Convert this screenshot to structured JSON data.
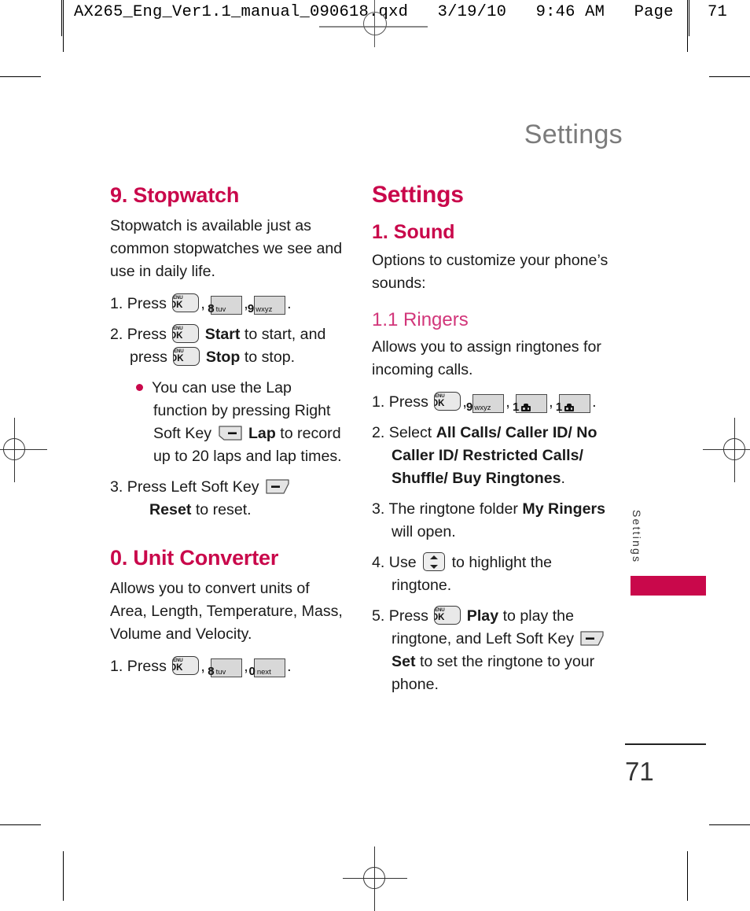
{
  "prepress": {
    "slug": "AX265_Eng_Ver1.1_manual_090618.qxd   3/19/10   9:46 AM   Page",
    "page_label": "71"
  },
  "running_header": "Settings",
  "side_tab": {
    "label": "Settings",
    "color": "#c9084b"
  },
  "folio": {
    "number": "71"
  },
  "colors": {
    "accent": "#c9084b",
    "accent_light": "#d2367a",
    "running_head": "#7b7b7b",
    "key_fill": "#d8d8d8",
    "menu_key_fill": "#e9e9e9"
  },
  "left_column": {
    "section_heading": "9. Stopwatch",
    "intro": "Stopwatch is available just as common stopwatches we see and use in daily life.",
    "step1": {
      "number": "1.",
      "verb": "Press",
      "keys": [
        "MENU/OK",
        "8 tuv",
        "9 wxyz"
      ],
      "trailing": "."
    },
    "step2": {
      "number": "2.",
      "text_a": "Press",
      "bold_a": "Start",
      "text_b": "to start, and press",
      "bold_b": "Stop",
      "text_c": "to stop."
    },
    "bullet": {
      "text_a": "You can use the Lap function by pressing Right Soft Key",
      "bold": "Lap",
      "text_b": "to record up to 20 laps and lap times."
    },
    "step3": {
      "number": "3.",
      "text_a": "Press Left Soft Key",
      "bold": "Reset",
      "text_b": "to reset."
    },
    "section_heading_2": "0. Unit Converter",
    "intro_2": "Allows you to convert units of Area, Length, Temperature, Mass, Volume and Velocity.",
    "step4": {
      "number": "1.",
      "verb": "Press",
      "keys": [
        "MENU/OK",
        "8 tuv",
        "0 next"
      ],
      "trailing": "."
    }
  },
  "right_column": {
    "section_heading": "Settings",
    "sub_heading": "1. Sound",
    "intro": "Options to customize your phone’s sounds:",
    "subsub_heading": "1.1 Ringers",
    "intro_2": "Allows you to assign ringtones for incoming calls.",
    "step1": {
      "number": "1.",
      "verb": "Press",
      "keys": [
        "MENU/OK",
        "9 wxyz",
        "1 voicemail",
        "1 voicemail"
      ],
      "trailing": "."
    },
    "step2": {
      "number": "2.",
      "text_a": "Select",
      "bold": "All Calls/ Caller ID/ No Caller ID/ Restricted Calls/ Shuffle/ Buy Ringtones",
      "text_b": "."
    },
    "step3": {
      "number": "3.",
      "text_a": "The ringtone folder",
      "bold": "My Ringers",
      "text_b": "will open."
    },
    "step4": {
      "number": "4.",
      "text_a": "Use",
      "text_b": "to highlight the ringtone."
    },
    "step5": {
      "number": "5.",
      "text_a": "Press",
      "bold_a": "Play",
      "text_b": "to play the ringtone, and Left Soft Key",
      "bold_b": "Set",
      "text_c": "to set the ringtone to your phone."
    }
  },
  "key_glyphs": {
    "menu_ok": {
      "line1": "MENU",
      "line2": "OK"
    },
    "eight": {
      "digit": "8",
      "letters": "tuv"
    },
    "nine": {
      "digit": "9",
      "letters": "wxyz"
    },
    "zero": {
      "digit": "0",
      "letters": "next"
    },
    "one": {
      "digit": "1",
      "letters": ""
    }
  }
}
